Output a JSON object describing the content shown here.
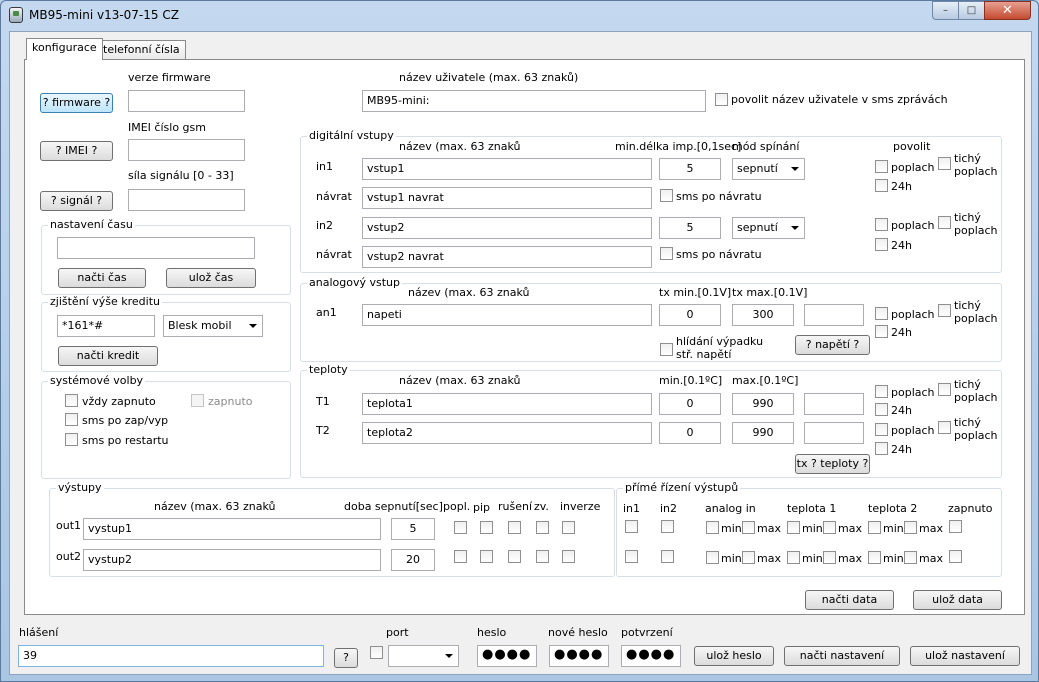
{
  "window": {
    "title": "MB95-mini v13-07-15 CZ",
    "min": "–",
    "max": "□",
    "close": "✕"
  },
  "tabs": [
    "konfigurace",
    "telefonní čísla"
  ],
  "firmware": {
    "label": "verze firmware",
    "button": "? firmware ?",
    "value": ""
  },
  "imei": {
    "label": "IMEI číslo gsm",
    "button": "? IMEI ?",
    "value": ""
  },
  "signal": {
    "label": "síla signálu [0 - 33]",
    "button": "? signál ?",
    "value": ""
  },
  "time": {
    "title": "nastavení času",
    "value": "",
    "read": "načti čas",
    "save": "ulož čas"
  },
  "credit": {
    "title": "zjištění výše kreditu",
    "code": "*161*#",
    "operator": "Blesk mobil",
    "button": "načti kredit"
  },
  "system": {
    "title": "systémové volby",
    "always_on": "vždy zapnuto",
    "on": "zapnuto",
    "sms_onoff": "sms po zap/vyp",
    "sms_restart": "sms po restartu"
  },
  "user": {
    "label": "název uživatele (max. 63 znaků)",
    "value": "MB95-mini:",
    "allow": "povolit název uživatele v sms zprávách"
  },
  "digital": {
    "title": "digitální vstupy",
    "h_name": "název (max.  63 znaků",
    "h_min": "min.délka imp.[0,1sec]",
    "h_mode": "mód spínání",
    "h_enable": "povolit",
    "inputs": [
      {
        "label": "in1",
        "name": "vstup1",
        "ret_label": "návrat",
        "ret_name": "vstup1 navrat",
        "min": "5",
        "mode": "sepnutí",
        "sms": "sms po návratu"
      },
      {
        "label": "in2",
        "name": "vstup2",
        "ret_label": "návrat",
        "ret_name": "vstup2 navrat",
        "min": "5",
        "mode": "sepnutí",
        "sms": "sms po návratu"
      }
    ]
  },
  "alarm": {
    "poplach": "poplach",
    "h24": "24h",
    "quiet1": "tichý",
    "quiet2": "poplach"
  },
  "analog": {
    "title": "analogový vstup",
    "h_name": "název (max.  63 znaků",
    "h_min": "tx min.[0.1V]",
    "h_max": "tx max.[0.1V]",
    "label": "an1",
    "name": "napeti",
    "min": "0",
    "max": "300",
    "extra": "",
    "watch1": "hlídání výpadku",
    "watch2": "stř. napětí",
    "button": "? napětí ?"
  },
  "temps": {
    "title": "teploty",
    "h_name": "název (max.  63 znaků",
    "h_min": "min.[0.1ºC]",
    "h_max": "max.[0.1ºC]",
    "rows": [
      {
        "label": "T1",
        "name": "teplota1",
        "min": "0",
        "max": "990",
        "extra": ""
      },
      {
        "label": "T2",
        "name": "teplota2",
        "min": "0",
        "max": "990",
        "extra": ""
      }
    ],
    "button": "tx ? teploty ?"
  },
  "outputs": {
    "title": "výstupy",
    "h_name": "název (max.  63 znaků",
    "h_dur": "doba sepnutí[sec]",
    "h_popl": "popl.",
    "h_pip": "pip",
    "h_rus": "rušení",
    "h_zv": "zv.",
    "h_inv": "inverze",
    "rows": [
      {
        "label": "out1",
        "name": "vystup1",
        "dur": "5"
      },
      {
        "label": "out2",
        "name": "vystup2",
        "dur": "20"
      }
    ]
  },
  "direct": {
    "title": "přímé řízení výstupů",
    "in1": "in1",
    "in2": "in2",
    "analog": "analog in",
    "t1": "teplota 1",
    "t2": "teplota 2",
    "on": "zapnuto",
    "min": "min",
    "max": "max"
  },
  "data_buttons": {
    "read": "načti data",
    "save": "ulož data"
  },
  "bottom": {
    "report_label": "hlášení",
    "report_value": "39",
    "q": "?",
    "port_label": "port",
    "port_value": "",
    "pass_label": "heslo",
    "pass_value": "●●●●",
    "newpass_label": "nové heslo",
    "newpass_value": "●●●●",
    "confirm_label": "potvrzení",
    "confirm_value": "●●●●",
    "save_pass": "ulož heslo",
    "read_settings": "načti nastavení",
    "save_settings": "ulož nastavení"
  }
}
